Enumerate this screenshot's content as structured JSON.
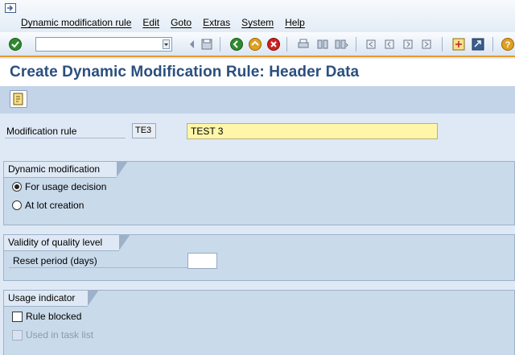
{
  "menubar": {
    "items": [
      "Dynamic modification rule",
      "Edit",
      "Goto",
      "Extras",
      "System",
      "Help"
    ]
  },
  "toolbar": {
    "command_field_value": "",
    "icons": [
      "enter-icon",
      "save-icon",
      "back-icon",
      "exit-icon",
      "cancel-icon",
      "print-icon",
      "find-icon",
      "find-next-icon",
      "first-page-icon",
      "previous-page-icon",
      "next-page-icon",
      "last-page-icon",
      "create-session-icon",
      "shortcut-icon",
      "help-icon"
    ]
  },
  "page": {
    "title": "Create Dynamic Modification Rule: Header Data"
  },
  "fields": {
    "modification_rule_label": "Modification rule",
    "modification_rule_code": "TE3",
    "modification_rule_text": "TEST 3"
  },
  "groups": {
    "dynamic_modification": {
      "title": "Dynamic modification",
      "options": [
        {
          "label": "For usage decision",
          "selected": true
        },
        {
          "label": "At lot creation",
          "selected": false
        }
      ]
    },
    "validity": {
      "title": "Validity of quality level",
      "reset_period_label": "Reset period (days)",
      "reset_period_value": ""
    },
    "usage_indicator": {
      "title": "Usage indicator",
      "rule_blocked_label": "Rule blocked",
      "rule_blocked_checked": false,
      "used_in_task_list_label": "Used in task list",
      "used_in_task_list_checked": false
    }
  },
  "colors": {
    "title": "#2a4f7f",
    "toolbar_accent": "#e79a2e",
    "highlight_field": "#fff6a9",
    "group_bg": "#c9daeb"
  }
}
